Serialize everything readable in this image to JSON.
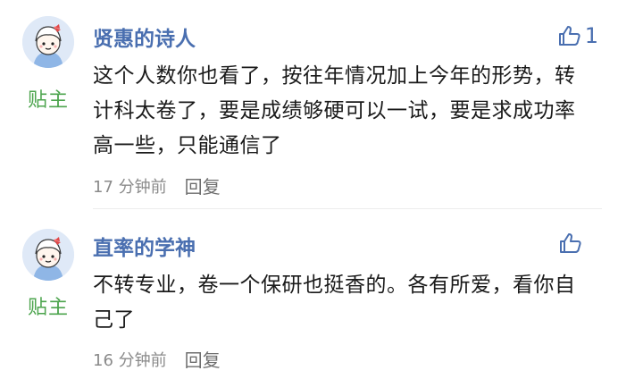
{
  "comments": [
    {
      "username": "贤惠的诗人",
      "badge": "贴主",
      "content": "这个人数你也看了，按往年情况加上今年的形势，转计科太卷了，要是成绩够硬可以一试，要是求成功率高一些，只能通信了",
      "time": "17 分钟前",
      "reply_label": "回复",
      "like_count": "1",
      "avatar_icon": "cartoon-girl-avatar-icon",
      "like_icon": "thumbs-up-icon"
    },
    {
      "username": "直率的学神",
      "badge": "贴主",
      "content": "不转专业，卷一个保研也挺香的。各有所爱，看你自己了",
      "time": "16 分钟前",
      "reply_label": "回复",
      "like_count": "",
      "avatar_icon": "cartoon-girl-avatar-icon",
      "like_icon": "thumbs-up-icon"
    }
  ],
  "colors": {
    "username": "#4a6fb0",
    "badge": "#4ca44d",
    "meta": "#8a8a8a",
    "avatar_bg": "#dfe9f7"
  }
}
